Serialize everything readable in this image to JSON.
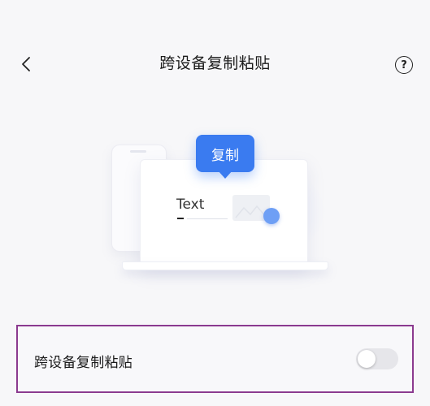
{
  "header": {
    "title": "跨设备复制粘贴",
    "back_icon": "chevron-left-icon",
    "help_icon": "question-circle-icon",
    "help_glyph": "?"
  },
  "illustration": {
    "copy_bubble_label": "复制",
    "sample_text": "Text",
    "accent_color": "#3a7bf0"
  },
  "setting": {
    "label": "跨设备复制粘贴",
    "toggle_on": false
  }
}
